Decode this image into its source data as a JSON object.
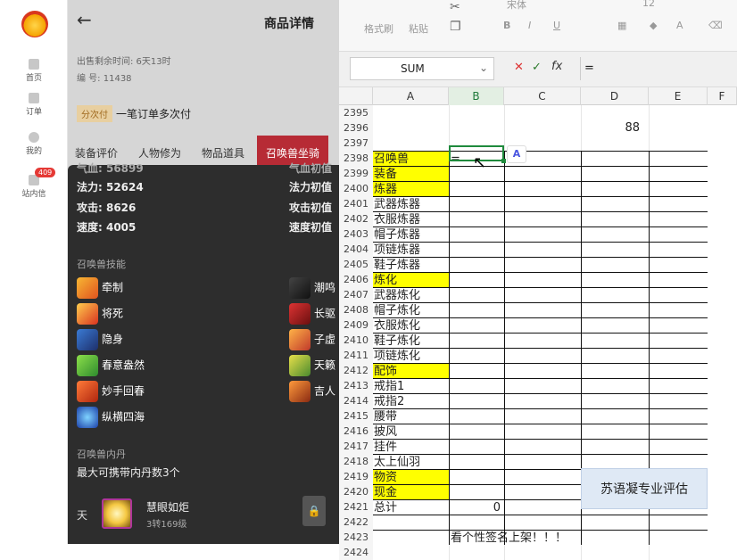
{
  "nav": {
    "items": [
      {
        "label": "首页"
      },
      {
        "label": "订单"
      },
      {
        "label": "我的"
      },
      {
        "label": "站内信"
      }
    ],
    "badge": "409"
  },
  "product": {
    "back": "←",
    "title": "商品详情",
    "remaining": "出售剩余时间: 6天13时",
    "number": "编 号: 11438",
    "installment_tag": "分次付",
    "installment_text": "一笔订单多次付",
    "tabs": [
      "装备评价",
      "人物修为",
      "物品道具",
      "召唤兽坐骑"
    ],
    "stats": [
      {
        "label": "气血: 56899",
        "right": "气血初值"
      },
      {
        "label": "法力: 52624",
        "right": "法力初值"
      },
      {
        "label": "攻击: 8626",
        "right": "攻击初值"
      },
      {
        "label": "速度: 4005",
        "right": "速度初值"
      }
    ],
    "skills_title": "召唤兽技能",
    "skills_left": [
      "牵制",
      "将死",
      "隐身",
      "春意盎然",
      "妙手回春",
      "纵横四海"
    ],
    "skills_right": [
      "潮鸣",
      "长驱",
      "子虚",
      "天籁",
      "吉人"
    ],
    "core_title": "召唤兽内丹",
    "core_limit": "最大可携带内丹数3个",
    "core_prefix": "天",
    "core_name": "慧眼如炬",
    "core_level": "3转169级"
  },
  "sheet": {
    "ribbon": {
      "format_painter": "格式刷",
      "paste": "粘贴",
      "font": "宋体",
      "size": "12"
    },
    "name_box": "SUM",
    "formula": "=",
    "columns": [
      "A",
      "B",
      "C",
      "D",
      "E",
      "F"
    ],
    "rows": [
      {
        "n": "2395",
        "a": ""
      },
      {
        "n": "2396",
        "a": "",
        "d": "88"
      },
      {
        "n": "2397",
        "a": ""
      },
      {
        "n": "2398",
        "a": "召唤兽",
        "yel": true,
        "b": "="
      },
      {
        "n": "2399",
        "a": "装备",
        "yel": true
      },
      {
        "n": "2400",
        "a": "炼器",
        "yel": true
      },
      {
        "n": "2401",
        "a": "武器炼器"
      },
      {
        "n": "2402",
        "a": "衣服炼器"
      },
      {
        "n": "2403",
        "a": "帽子炼器"
      },
      {
        "n": "2404",
        "a": "项链炼器"
      },
      {
        "n": "2405",
        "a": "鞋子炼器"
      },
      {
        "n": "2406",
        "a": "炼化",
        "yel": true
      },
      {
        "n": "2407",
        "a": "武器炼化"
      },
      {
        "n": "2408",
        "a": "帽子炼化"
      },
      {
        "n": "2409",
        "a": "衣服炼化"
      },
      {
        "n": "2410",
        "a": "鞋子炼化"
      },
      {
        "n": "2411",
        "a": "项链炼化"
      },
      {
        "n": "2412",
        "a": "配饰",
        "yel": true
      },
      {
        "n": "2413",
        "a": "戒指1"
      },
      {
        "n": "2414",
        "a": "戒指2"
      },
      {
        "n": "2415",
        "a": "腰带"
      },
      {
        "n": "2416",
        "a": "披风"
      },
      {
        "n": "2417",
        "a": "挂件"
      },
      {
        "n": "2418",
        "a": "太上仙羽"
      },
      {
        "n": "2419",
        "a": "物资",
        "yel": true
      },
      {
        "n": "2420",
        "a": "现金",
        "yel": true
      },
      {
        "n": "2421",
        "a": "总计",
        "b": "0"
      },
      {
        "n": "2422",
        "a": ""
      },
      {
        "n": "2423",
        "a": "",
        "b": "看个性签名上架！！！"
      },
      {
        "n": "2424",
        "a": ""
      }
    ],
    "eval_box": "苏语凝专业评估"
  }
}
